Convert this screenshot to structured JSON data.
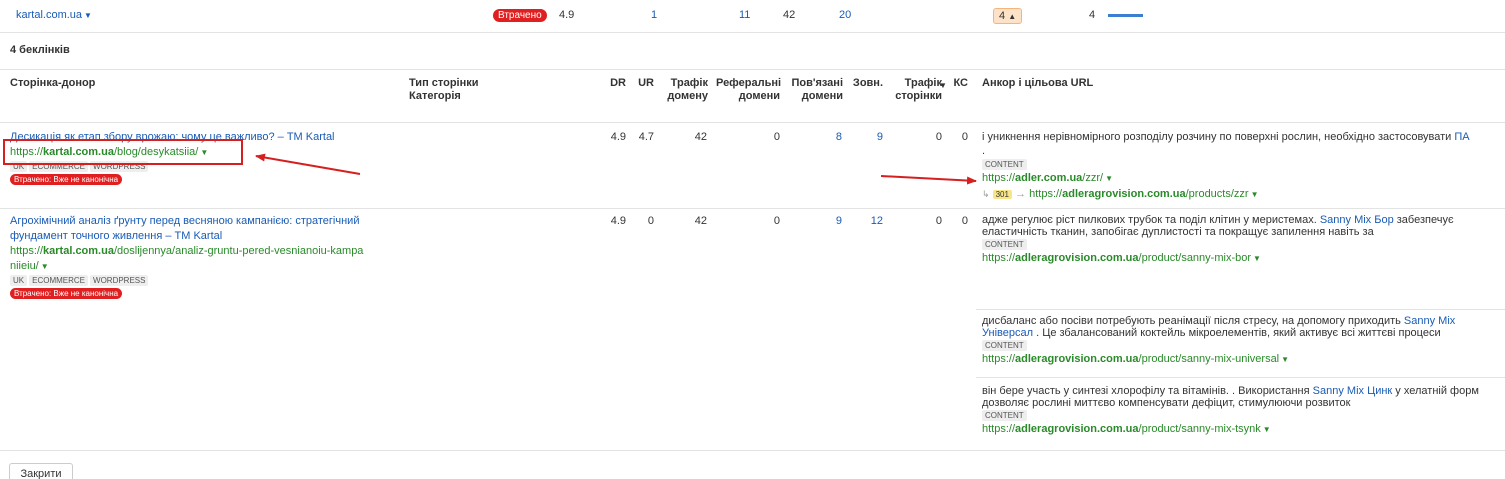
{
  "topbar": {
    "domain": "kartal.com.ua",
    "status": "Втрачено",
    "dr": "4.9",
    "v1": "1",
    "v2": "11",
    "v3": "42",
    "v4": "20",
    "badge": "4",
    "count": "4",
    "fill_fraction": 0.5
  },
  "section": {
    "title": "4 беклінків"
  },
  "headers": {
    "donor": "Сторінка-донор",
    "type": "Тип сторінки",
    "category": "Категорія",
    "dr": "DR",
    "ur": "UR",
    "traffic_domain": "Трафік домену",
    "ref_domains": "Реферальні домени",
    "linked_domains": "Пов'язані домени",
    "ext": "Зовн.",
    "traffic_page": "Трафік сторінки",
    "kc": "КС",
    "anchor": "Анкор і цільова URL"
  },
  "rows": [
    {
      "title": "Десикація як етап збору врожаю: чому це важливо? – ТМ Kartal",
      "url_prefix": "https://",
      "url_host": "kartal.com.ua",
      "url_path": "/blog/desykatsiia/",
      "tags": [
        "UK",
        "ECOMMERCE",
        "WORDPRESS"
      ],
      "status": "Втрачено: Вже не канонічна",
      "dr": "4.9",
      "ur": "4.7",
      "traffic_domain": "42",
      "ref_domains": "0",
      "linked_domains": "8",
      "ext": "9",
      "traffic_page": "0",
      "kc": "0",
      "anchors": [
        {
          "text": "і уникнення нерівномірного розподілу розчину по поверхні рослин, необхідно застосовувати",
          "link": "ПА",
          "after": ".",
          "tag": "CONTENT",
          "target_prefix": "https://",
          "target_host": "adler.com.ua",
          "target_path": "/zzr/",
          "redirect_code": "301",
          "redirect_prefix": "https://",
          "redirect_host": "adleragrovision.com.ua",
          "redirect_path": "/products/zzr"
        }
      ]
    },
    {
      "title_line1": "Агрохімічний аналіз ґрунту перед весняною кампанією: стратегічний",
      "title_line2": "фундамент точного живлення – ТМ Kartal",
      "url_prefix": "https://",
      "url_host": "kartal.com.ua",
      "url_path1": "/doslijennya/analiz-gruntu-pered-vesnianoiu-kampa",
      "url_path2": "niieiu/",
      "tags": [
        "UK",
        "ECOMMERCE",
        "WORDPRESS"
      ],
      "status": "Втрачено: Вже не канонічна",
      "dr": "4.9",
      "ur": "0",
      "traffic_domain": "42",
      "ref_domains": "0",
      "linked_domains": "9",
      "ext": "12",
      "traffic_page": "0",
      "kc": "0",
      "anchors": [
        {
          "text_before": "адже регулює ріст пилкових трубок та поділ клітин у меристемах.",
          "link": "Sanny Mix Бор",
          "text_after": "забезпечує",
          "line2": "еластичність тканин, запобігає дуплистості та покращує запилення навіть за",
          "tag": "CONTENT",
          "target_prefix": "https://",
          "target_host": "adleragrovision.com.ua",
          "target_path": "/product/sanny-mix-bor"
        },
        {
          "text_before": "дисбаланс або посіви потребують реанімації після стресу, на допомогу приходить",
          "link1": "Sanny Mix",
          "link2": "Універсал",
          "text_after": ". Це збалансований коктейль мікроелементів, який активує всі життєві процеси",
          "tag": "CONTENT",
          "target_prefix": "https://",
          "target_host": "adleragrovision.com.ua",
          "target_path": "/product/sanny-mix-universal"
        },
        {
          "text_before": "він бере участь у синтезі хлорофілу та вітамінів. . Використання",
          "link": "Sanny Mix Цинк",
          "text_after": "у хелатній форм",
          "line2": "дозволяє рослині миттєво компенсувати дефіцит, стимулюючи розвиток",
          "tag": "CONTENT",
          "target_prefix": "https://",
          "target_host": "adleragrovision.com.ua",
          "target_path": "/product/sanny-mix-tsynk"
        }
      ]
    }
  ],
  "footer": {
    "close_label": "Закрити"
  },
  "colors": {
    "link": "#1a5bb5",
    "url_green": "#2a8a2a",
    "lost_red": "#e02020",
    "annotation_red": "#d61f1f"
  }
}
